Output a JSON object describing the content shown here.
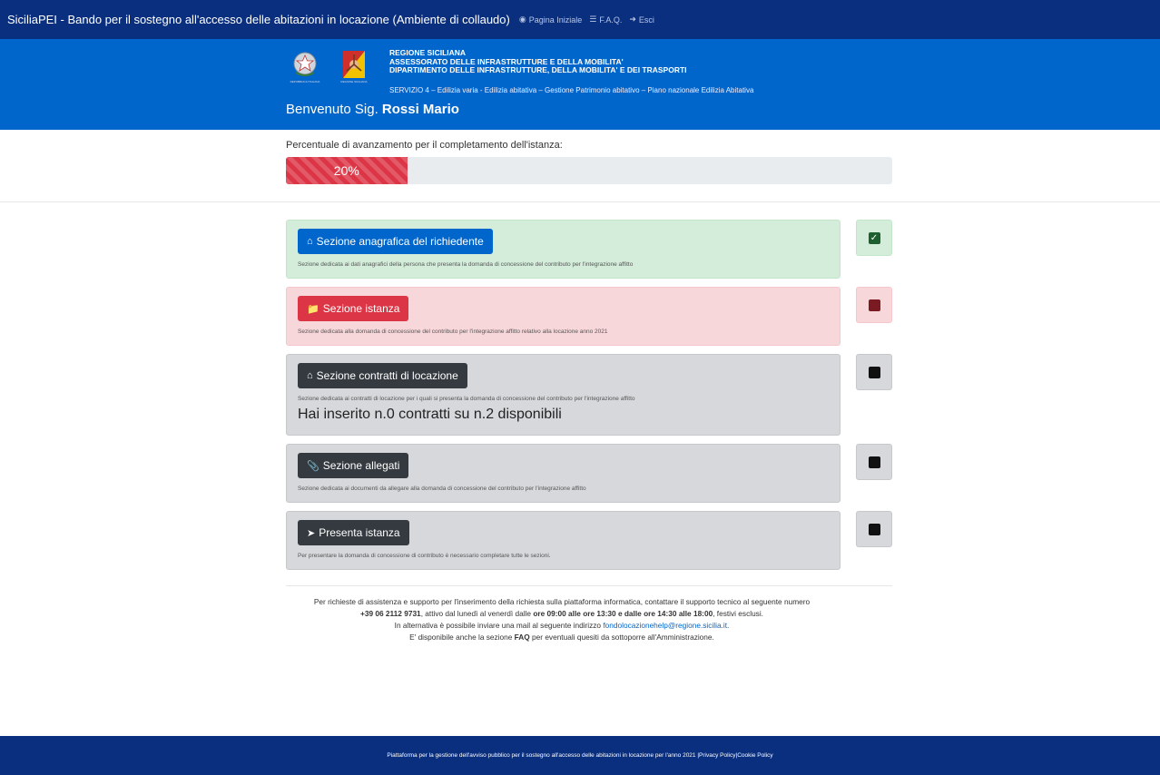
{
  "topbar": {
    "title": "SiciliaPEI - Bando per il sostegno all'accesso delle abitazioni in locazione (Ambiente di collaudo)",
    "nav": [
      {
        "label": "Pagina Iniziale",
        "icon": "dashboard-icon"
      },
      {
        "label": "F.A.Q.",
        "icon": "list-icon"
      },
      {
        "label": "Esci",
        "icon": "logout-icon"
      }
    ]
  },
  "header": {
    "logo_left_caption": "REPUBBLICA ITALIANA",
    "logo_right_caption": "REGIONE SICILIANA",
    "org_line1": "REGIONE SICILIANA",
    "org_line2": "ASSESSORATO DELLE INFRASTRUTTURE E DELLA MOBILITA'",
    "org_line3": "DIPARTIMENTO DELLE INFRASTRUTTURE, DELLA MOBILITA' E DEI TRASPORTI",
    "service": "SERVIZIO 4 – Edilizia varia - Edilizia abitativa – Gestione Patrimonio abitativo – Piano nazionale Edilizia Abitativa",
    "welcome_prefix": "Benvenuto Sig.",
    "user_name": "Rossi Mario"
  },
  "progress": {
    "label": "Percentuale di avanzamento per il completamento dell'istanza:",
    "value": 20,
    "text": "20%"
  },
  "sections": [
    {
      "label": "Sezione anagrafica del richiedente",
      "icon": "house-user-icon",
      "desc": "Sezione dedicata ai dati anagrafici della persona che presenta la domanda di concessione del contributo per l'integrazione affitto",
      "status": "complete"
    },
    {
      "label": "Sezione istanza",
      "icon": "folder-open-icon",
      "desc": "Sezione dedicata alla domanda di concessione del contributo per l'integrazione affitto relativo alla locazione anno 2021",
      "status": "incomplete"
    },
    {
      "label": "Sezione contratti di locazione",
      "icon": "house-exchange-icon",
      "desc": "Sezione dedicata ai contratti di locazione per i quali si presenta la domanda di concessione del contributo per l'integrazione affitto",
      "extra": "Hai inserito n.0 contratti su n.2 disponibili",
      "status": "pending"
    },
    {
      "label": "Sezione allegati",
      "icon": "paperclip-icon",
      "desc": "Sezione dedicata ai documenti da allegare alla domanda di concessione del contributo per l'integrazione affitto",
      "status": "pending"
    },
    {
      "label": "Presenta istanza",
      "icon": "paper-plane-icon",
      "desc": "Per presentare la domanda di concessione di contributo è necessario completare tutte le sezioni.",
      "status": "pending"
    }
  ],
  "support": {
    "line1": "Per richieste di assistenza e supporto per l'inserimento della richiesta sulla piattaforma informatica, contattare il supporto tecnico al seguente numero",
    "phone": "+39 06 2112 9731",
    "line2a": ", attivo dal lunedì al venerdì dalle ",
    "hours": "ore 09:00 alle ore 13:30 e dalle ore 14:30 alle 18:00",
    "line2b": ", festivi esclusi.",
    "line3a": "In alternativa è possibile inviare una mail al seguente indirizzo ",
    "email": "fondolocazionehelp@regione.sicilia.it",
    "line3b": ".",
    "line4a": "E' disponibile anche la sezione ",
    "faq": "FAQ",
    "line4b": " per eventuali quesiti da sottoporre all'Amministrazione."
  },
  "footer": {
    "text": "Piattaforma per la gestione dell'avviso pubblico per il sostegno all'accesso delle abitazioni in locazione per l'anno 2021 | ",
    "privacy": "Privacy Policy",
    "sep": " | ",
    "cookie": "Cookie Policy"
  },
  "colors": {
    "navy": "#0a2f7e",
    "blue": "#0066cc",
    "red": "#dc3545",
    "dark": "#343a40",
    "green_check": "#1e5f2f",
    "red_box": "#7a1b23"
  }
}
